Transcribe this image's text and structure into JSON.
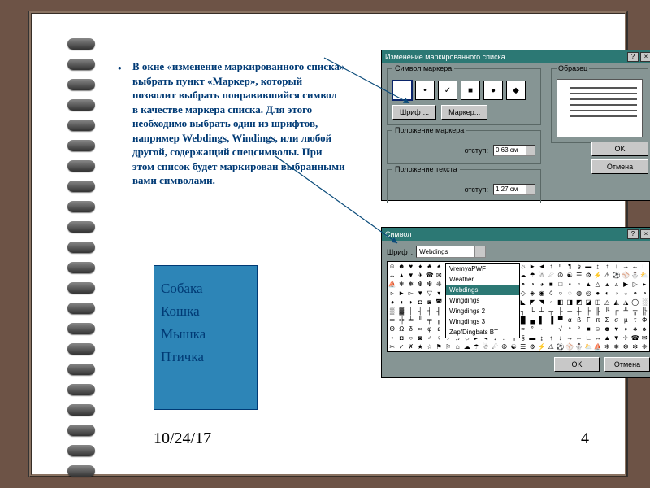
{
  "slide": {
    "body_text": "В окне «изменение маркированного списка» выбрать пункт «Маркер», который позволит выбрать понравившийся символ в качестве маркера списка. Для этого необходимо выбрать один из шрифтов, например Webdings, Windings, или любой другой, содержащий спецсимволы. При этом список будет маркирован выбранными вами символами.",
    "list_items": [
      "Собака",
      "Кошка",
      "Мышка",
      "Птичка"
    ],
    "date": "10/24/17",
    "page_number": "4"
  },
  "dialog1": {
    "title": "Изменение маркированного списка",
    "group_marker": "Символ маркера",
    "btn_font": "Шрифт...",
    "btn_marker": "Маркер...",
    "group_position": "Положение маркера",
    "group_text_pos": "Положение текста",
    "label_indent": "отступ:",
    "indent1": "0.63 см",
    "indent2": "1.27 см",
    "preview_label": "Образец",
    "btn_ok": "OK",
    "btn_cancel": "Отмена",
    "markers": [
      "",
      "•",
      "✓",
      "■",
      "●",
      "◆"
    ]
  },
  "dialog2": {
    "title": "Символ",
    "label_font": "Шрифт:",
    "font_value": "Webdings",
    "dropdown": [
      "VremyaPWF",
      "Weather",
      "Webdings",
      "Wingdings",
      "Wingdings 2",
      "Wingdings 3",
      "ZapfDingbats BT"
    ],
    "dropdown_selected_index": 2,
    "btn_ok": "OK",
    "btn_cancel": "Отмена"
  }
}
